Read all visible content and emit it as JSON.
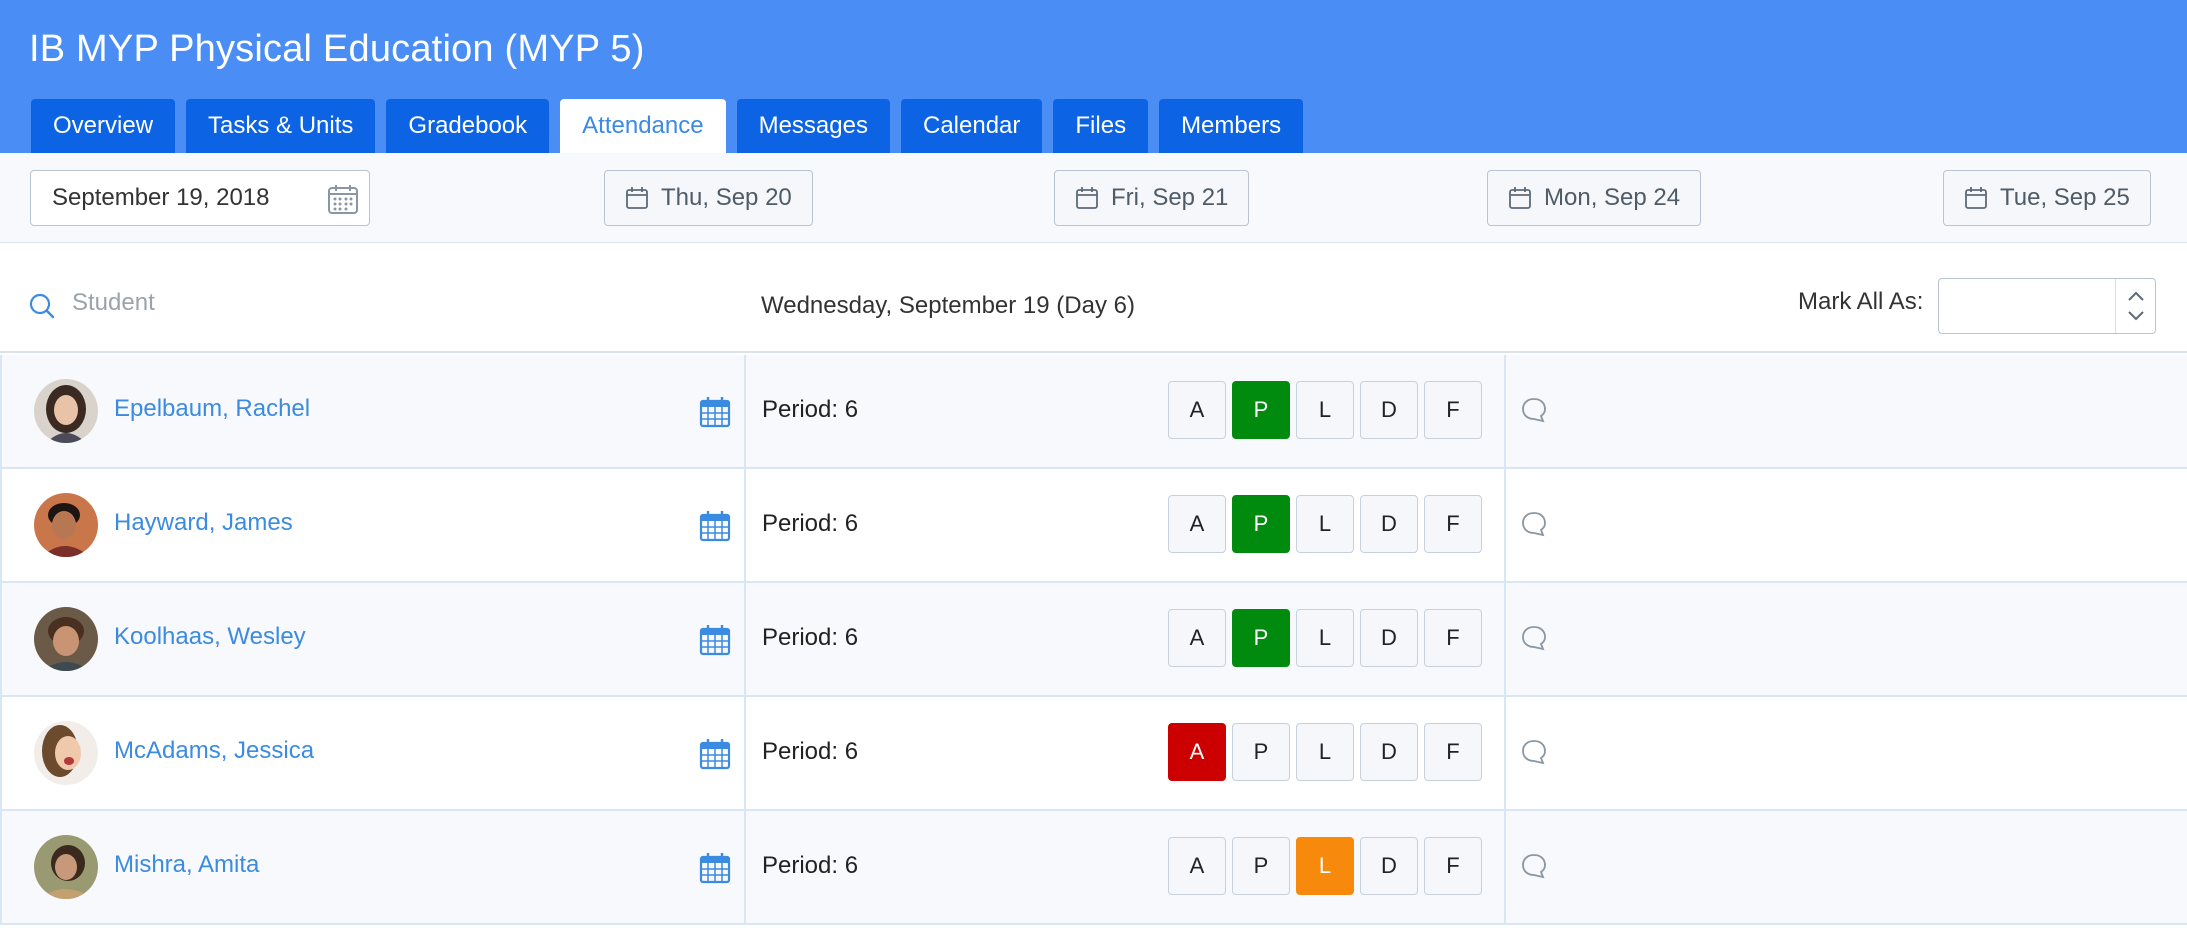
{
  "course": {
    "title": "IB MYP Physical Education (MYP 5)"
  },
  "tabs": [
    {
      "label": "Overview"
    },
    {
      "label": "Tasks & Units"
    },
    {
      "label": "Gradebook"
    },
    {
      "label": "Attendance",
      "active": true
    },
    {
      "label": "Messages"
    },
    {
      "label": "Calendar"
    },
    {
      "label": "Files"
    },
    {
      "label": "Members"
    }
  ],
  "datebar": {
    "selected_date": "September 19, 2018",
    "days": [
      {
        "label": "Thu, Sep 20"
      },
      {
        "label": "Fri, Sep 21"
      },
      {
        "label": "Mon, Sep 24"
      },
      {
        "label": "Tue, Sep 25"
      }
    ]
  },
  "filter": {
    "search_placeholder": "Student",
    "search_value": "",
    "day_heading": "Wednesday, September 19 (Day 6)",
    "mark_all_label": "Mark All As:",
    "mark_all_value": ""
  },
  "codes": [
    "A",
    "P",
    "L",
    "D",
    "F"
  ],
  "students": [
    {
      "name": "Epelbaum, Rachel",
      "period": "Period: 6",
      "status": "P"
    },
    {
      "name": "Hayward, James",
      "period": "Period: 6",
      "status": "P"
    },
    {
      "name": "Koolhaas, Wesley",
      "period": "Period: 6",
      "status": "P"
    },
    {
      "name": "McAdams, Jessica",
      "period": "Period: 6",
      "status": "A"
    },
    {
      "name": "Mishra, Amita",
      "period": "Period: 6",
      "status": "L"
    }
  ],
  "colors": {
    "header": "#4a8ef5",
    "tab": "#0c63e4",
    "link": "#3b8be0",
    "present": "#008a0e",
    "absent": "#cc0000",
    "late": "#f7890c"
  }
}
